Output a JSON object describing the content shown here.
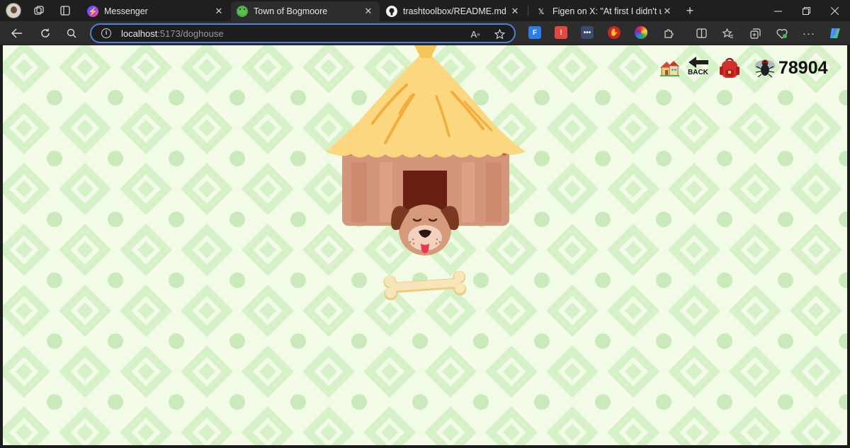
{
  "browser": {
    "tabs": [
      {
        "label": "Messenger",
        "favicon": "messenger-icon"
      },
      {
        "label": "Town of Bogmoore",
        "favicon": "frog-icon",
        "active": true
      },
      {
        "label": "trashtoolbox/README.md at ma",
        "favicon": "github-icon"
      },
      {
        "label": "Figen on X: \"At first I didn't unde",
        "favicon": "x-icon"
      }
    ],
    "new_tab_symbol": "+",
    "url_host": "localhost",
    "url_rest": ":5173/doghouse"
  },
  "page": {
    "hud": {
      "home_icon": "house-icon",
      "back_label": "BACK",
      "backpack_icon": "backpack-icon",
      "fly_icon": "fly-icon",
      "fly_count": "78904"
    },
    "scene": [
      "doghouse",
      "sleeping-dog",
      "bone"
    ]
  },
  "colors": {
    "background": "#f1fbe6",
    "pattern_diamond": "#d4efc6",
    "pattern_dot": "#c9e9b8",
    "roof": "#fbd77f",
    "house_wall": "#d4967a",
    "house_door": "#6a1f12",
    "dog_fur": "#d49a79",
    "dog_ears": "#7a3a22",
    "bone": "#f6e2b0",
    "address_bar_focus": "#4f7fd6"
  }
}
